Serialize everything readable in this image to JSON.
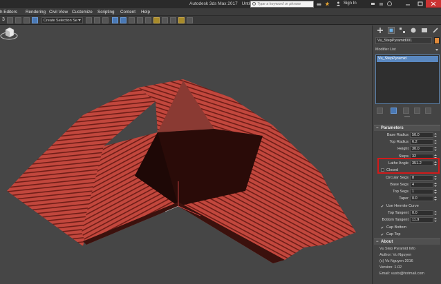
{
  "titlebar": {
    "app": "Autodesk 3ds Max 2017",
    "doc": "Untitled",
    "search_placeholder": "Type a keyword or phrase",
    "signin": "Sign In"
  },
  "menu": [
    "h Editors",
    "Rendering",
    "Civil View",
    "Customize",
    "Scripting",
    "Content",
    "Help"
  ],
  "toolbar": {
    "number": "3",
    "selection_set": "Create Selection Se"
  },
  "panel": {
    "object_name": "Vu_StepPyramid001",
    "object_color": "#e08a3a",
    "modifier_list_label": "Modifier List",
    "stack_item": "Vu_StepPyramid",
    "parameters": {
      "title": "Parameters",
      "rows": [
        {
          "label": "Base Radius",
          "value": "50.0"
        },
        {
          "label": "Top Radius",
          "value": "6.2"
        },
        {
          "label": "Height",
          "value": "30.0"
        },
        {
          "label": "Steps",
          "value": "32"
        },
        {
          "label": "Lathe Angle",
          "value": "351.2"
        }
      ],
      "closed_label": "Closed",
      "rows2": [
        {
          "label": "Circular Segs",
          "value": "8"
        },
        {
          "label": "Base Segs",
          "value": "4"
        },
        {
          "label": "Top Segs",
          "value": "1"
        },
        {
          "label": "Taper",
          "value": "0.0"
        }
      ],
      "hermite_label": "Use Hermite Curve",
      "rows3": [
        {
          "label": "Top Tangent",
          "value": "0.0"
        },
        {
          "label": "Bottom Tangent",
          "value": "11.9"
        }
      ],
      "cap_bottom": "Cap Bottom",
      "cap_top": "Cap Top"
    },
    "about": {
      "title": "About",
      "lines": [
        "Vu Step Pyramid Info",
        "Author: Vu Nguyen",
        "(c) Vu Nguyen 2016",
        "Version: 1.02",
        "Email: vustx@hotmail.com"
      ]
    }
  },
  "viewport": {
    "object_color": "#c0483e",
    "interior_color": "#2a0b08"
  }
}
